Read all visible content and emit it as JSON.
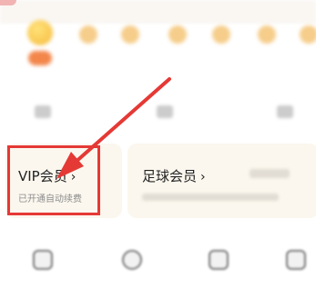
{
  "membership": {
    "vip": {
      "title": "VIP会员",
      "subtitle": "已开通自动续费"
    },
    "football": {
      "title": "足球会员"
    }
  },
  "colors": {
    "annotation": "#e53935",
    "card_bg": "#fbf7ee",
    "coin": "#f6cd8a"
  },
  "icons": [
    "chevron-right-icon",
    "arrow-annotation-icon",
    "coin-icon"
  ]
}
